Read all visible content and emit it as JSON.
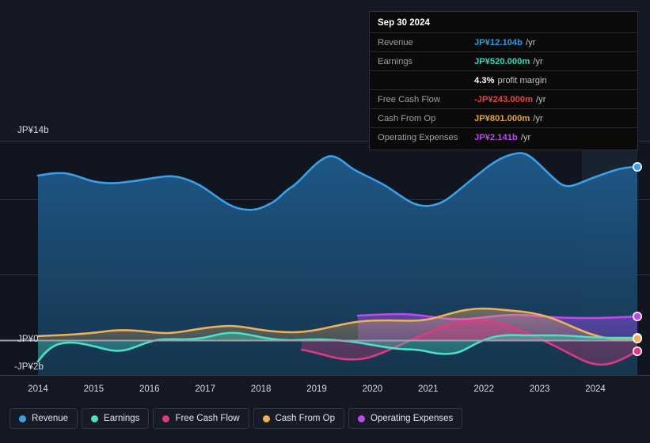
{
  "tooltip": {
    "date": "Sep 30 2024",
    "rows": [
      {
        "key": "Revenue",
        "value": "JP¥12.104b",
        "unit": "/yr",
        "color": "#2e9ae0"
      },
      {
        "key": "Earnings",
        "value": "JP¥520.000m",
        "unit": "/yr",
        "color": "#34d6bb"
      },
      {
        "key": "",
        "value": "4.3%",
        "unit": "profit margin",
        "color": "#ffffff"
      },
      {
        "key": "Free Cash Flow",
        "value": "-JP¥243.000m",
        "unit": "/yr",
        "color": "#e8463c"
      },
      {
        "key": "Cash From Op",
        "value": "JP¥801.000m",
        "unit": "/yr",
        "color": "#e3a33a"
      },
      {
        "key": "Operating Expenses",
        "value": "JP¥2.141b",
        "unit": "/yr",
        "color": "#b84ae8"
      }
    ]
  },
  "axes": {
    "y_top_label": "JP¥14b",
    "y_zero_label": "JP¥0",
    "y_bottom_label": "-JP¥2b",
    "x_ticks": [
      "2014",
      "2015",
      "2016",
      "2017",
      "2018",
      "2019",
      "2020",
      "2021",
      "2022",
      "2023",
      "2024"
    ]
  },
  "legend": [
    {
      "label": "Revenue",
      "color": "#3aa0e8"
    },
    {
      "label": "Earnings",
      "color": "#4ce0c4"
    },
    {
      "label": "Free Cash Flow",
      "color": "#e0397f"
    },
    {
      "label": "Cash From Op",
      "color": "#efb05a"
    },
    {
      "label": "Operating Expenses",
      "color": "#bf4ae8"
    }
  ],
  "chart_data": {
    "type": "area",
    "title": "",
    "xlabel": "",
    "ylabel": "",
    "ylim": [
      -2,
      14
    ],
    "ytick_values": [
      14,
      0,
      -2
    ],
    "ytick_labels": [
      "JP¥14b",
      "JP¥0",
      "-JP¥2b"
    ],
    "gridlines": [
      14,
      10,
      5
    ],
    "currency": "JP¥",
    "units": "billions",
    "x": [
      "2014",
      "2015",
      "2016",
      "2017",
      "2018",
      "2019",
      "2020",
      "2021",
      "2022",
      "2023",
      "2024 Q3"
    ],
    "legend_position": "bottom",
    "grid": true,
    "series": [
      {
        "name": "Revenue",
        "color": "#3aa0e8",
        "fill": "#1d4a72",
        "values": [
          11.0,
          10.4,
          10.7,
          9.2,
          10.3,
          12.1,
          10.6,
          8.8,
          11.7,
          13.0,
          12.104
        ]
      },
      {
        "name": "Earnings",
        "color": "#4ce0c4",
        "fill": "#2c6c66",
        "values": [
          -0.85,
          0.05,
          -0.25,
          0.15,
          0.45,
          0.25,
          0.1,
          -0.15,
          0.35,
          0.45,
          0.52
        ]
      },
      {
        "name": "Free Cash Flow",
        "color": "#e0397f",
        "fill": "#6d2545",
        "values": [
          null,
          null,
          null,
          null,
          null,
          -0.4,
          -0.15,
          0.55,
          1.45,
          0.35,
          -0.243
        ]
      },
      {
        "name": "Cash From Op",
        "color": "#efb05a",
        "fill": "#5c4a33",
        "values": [
          0.35,
          0.45,
          0.6,
          0.45,
          0.8,
          0.75,
          1.1,
          1.55,
          1.9,
          1.3,
          0.801
        ]
      },
      {
        "name": "Operating Expenses",
        "color": "#bf4ae8",
        "fill": "#4a3a88",
        "values": [
          null,
          null,
          null,
          null,
          null,
          2.3,
          2.35,
          2.2,
          2.28,
          2.2,
          2.141
        ]
      }
    ]
  }
}
